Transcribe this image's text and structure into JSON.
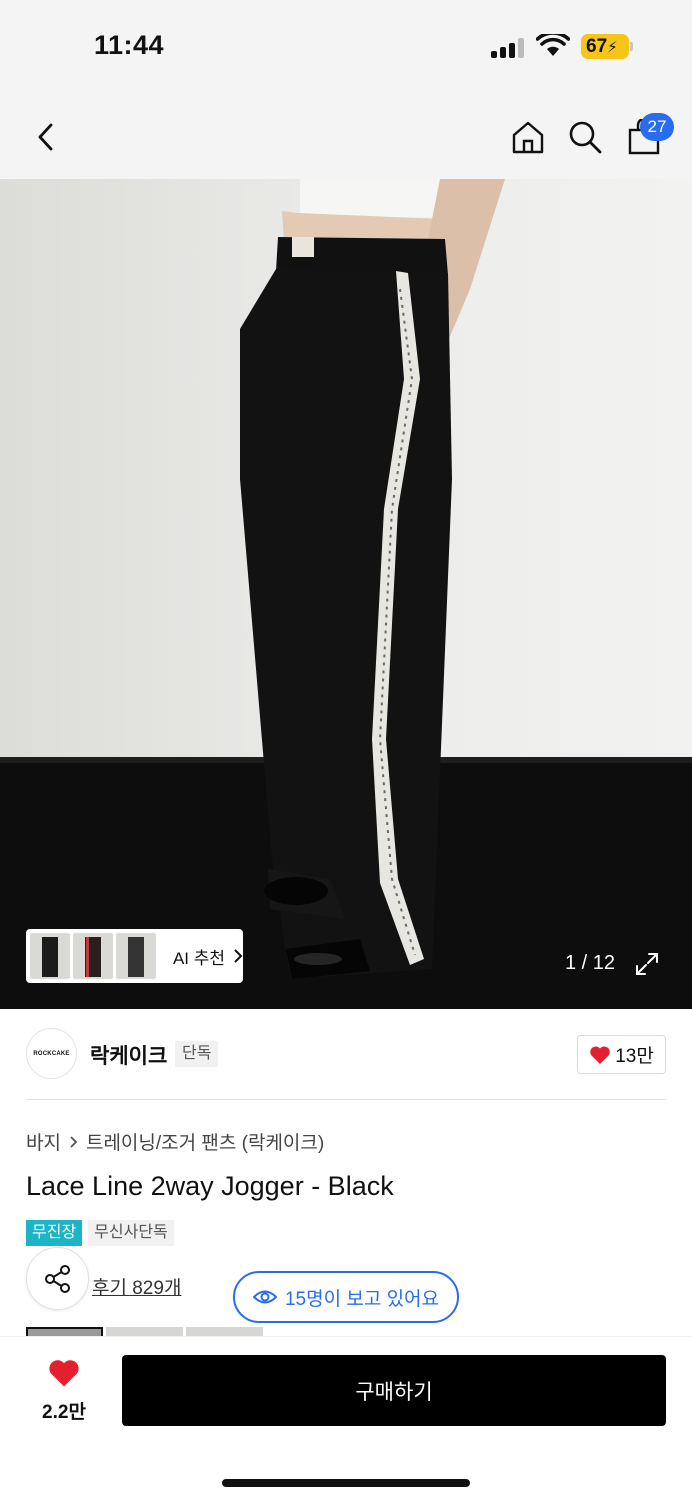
{
  "status_bar": {
    "time": "11:44",
    "battery": "67"
  },
  "nav": {
    "back_icon": "chevron-left-icon",
    "home_icon": "home-icon",
    "search_icon": "search-icon",
    "cart_icon": "shopping-bag-icon",
    "cart_count": "27"
  },
  "gallery": {
    "counter": "1 / 12",
    "ai_label": "AI 추천",
    "expand_icon": "expand-icon"
  },
  "brand": {
    "logo_text": "ROCKCAKE",
    "name": "락케이크",
    "tag": "단독",
    "likes": "13만"
  },
  "product": {
    "breadcrumb": [
      "바지",
      "트레이닝/조거 팬츠 (락케이크)"
    ],
    "title": "Lace Line 2way Jogger - Black",
    "badges": [
      "무진장",
      "무신사단독"
    ],
    "reviews": "후기 829개",
    "viewing": "15명이 보고 있어요"
  },
  "bottom": {
    "wish_count": "2.2만",
    "buy_label": "구매하기"
  },
  "colors": {
    "accent_blue": "#2a6cf0",
    "badge_teal": "#1db4c6",
    "heart_red": "#e5202e",
    "battery_yellow": "#f5c518"
  }
}
